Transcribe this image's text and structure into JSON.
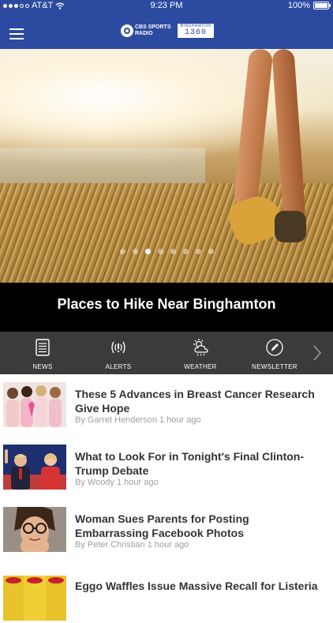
{
  "status_bar": {
    "carrier": "AT&T",
    "time": "9:23 PM",
    "battery": "100%"
  },
  "header": {
    "logo_line1": "CBS SPORTS",
    "logo_line2": "RADIO",
    "logo_city": "BINGHAMTON",
    "logo_frequency": "1360"
  },
  "hero": {
    "caption": "Places to Hike Near Binghamton",
    "pages": 8,
    "active_page": 2
  },
  "quick_nav": [
    {
      "label": "NEWS",
      "icon": "news-icon"
    },
    {
      "label": "ALERTS",
      "icon": "alerts-icon"
    },
    {
      "label": "WEATHER",
      "icon": "weather-icon"
    },
    {
      "label": "NEWSLETTER",
      "icon": "newsletter-icon"
    }
  ],
  "articles": [
    {
      "title": "These 5 Advances in Breast Cancer Research Give Hope",
      "byline": "By Garret Henderson 1 hour ago"
    },
    {
      "title": "What to Look For in Tonight's Final Clinton-Trump Debate",
      "byline": "By Woody 1 hour ago"
    },
    {
      "title": "Woman Sues Parents for Posting Embarrassing Facebook Photos",
      "byline": "By Peter Christian 1 hour ago"
    },
    {
      "title": "Eggo Waffles Issue Massive Recall for Listeria",
      "byline": ""
    }
  ],
  "colors": {
    "brand_blue": "#2c4aa0",
    "quicknav_bg": "#3b3b3b",
    "byline_gray": "#a0a0a0"
  }
}
